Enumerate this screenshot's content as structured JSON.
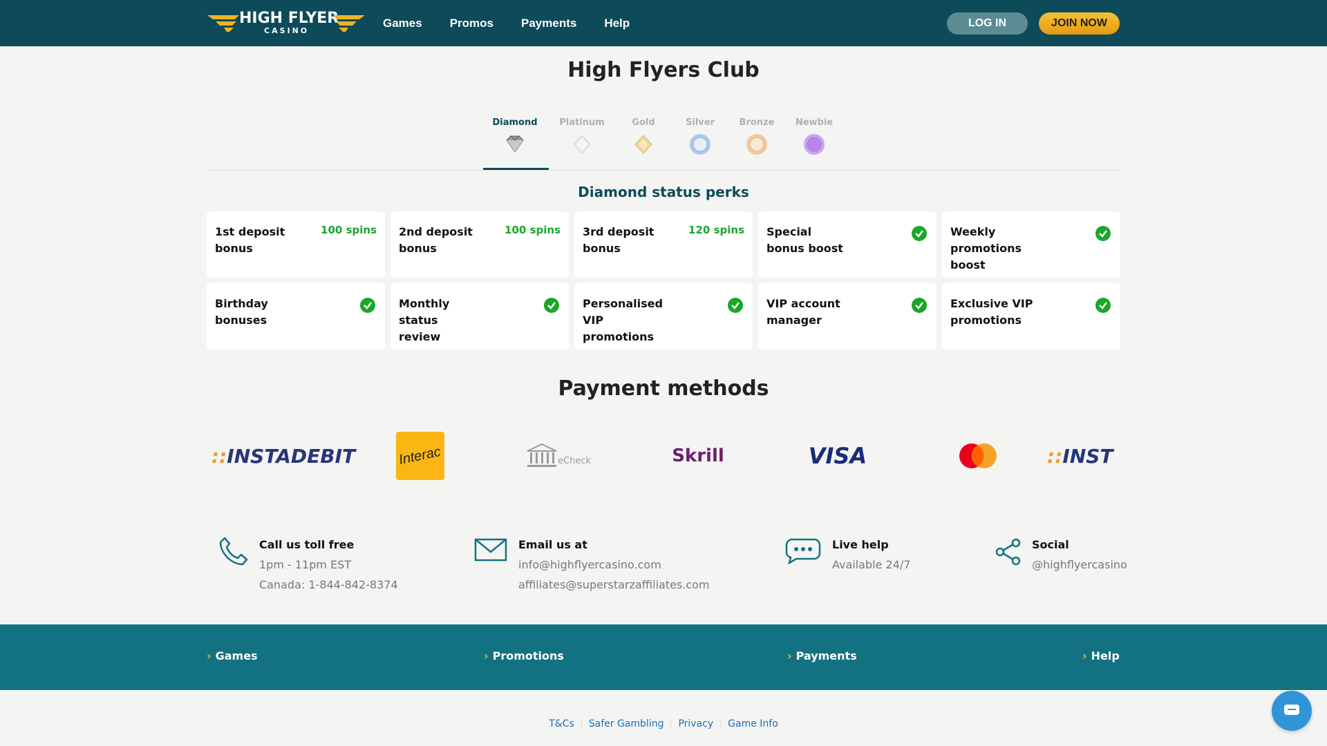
{
  "header": {
    "logo_text": "HIGH FLYER",
    "logo_sub": "CASINO",
    "nav": [
      "Games",
      "Promos",
      "Payments",
      "Help"
    ],
    "login_label": "LOG IN",
    "join_label": "JOIN NOW"
  },
  "club": {
    "title": "High Flyers Club",
    "tiers": [
      {
        "label": "Diamond",
        "active": true
      },
      {
        "label": "Platinum",
        "active": false
      },
      {
        "label": "Gold",
        "active": false
      },
      {
        "label": "Silver",
        "active": false
      },
      {
        "label": "Bronze",
        "active": false
      },
      {
        "label": "Newbie",
        "active": false
      }
    ],
    "perks_title": "Diamond status perks",
    "perks": [
      {
        "label_lines": [
          "1st deposit",
          "bonus"
        ],
        "value": "100 spins"
      },
      {
        "label_lines": [
          "2nd deposit",
          "bonus"
        ],
        "value": "100 spins"
      },
      {
        "label_lines": [
          "3rd deposit",
          "bonus"
        ],
        "value": "120 spins"
      },
      {
        "label_lines": [
          "Special",
          "bonus boost"
        ],
        "check": true
      },
      {
        "label_lines": [
          "Weekly",
          "promotions",
          "boost"
        ],
        "check": true
      },
      {
        "label_lines": [
          "Birthday",
          "bonuses"
        ],
        "check": true
      },
      {
        "label_lines": [
          "Monthly",
          "status",
          "review"
        ],
        "check": true
      },
      {
        "label_lines": [
          "Personalised",
          "VIP",
          "promotions"
        ],
        "check": true
      },
      {
        "label_lines": [
          "VIP account",
          "manager"
        ],
        "check": true
      },
      {
        "label_lines": [
          "Exclusive VIP",
          "promotions"
        ],
        "check": true
      }
    ]
  },
  "payments": {
    "title": "Payment methods",
    "methods": [
      "INSTADEBIT",
      "Interac",
      "eCheck",
      "Skrill",
      "VISA",
      "Mastercard",
      "INST"
    ]
  },
  "contacts": [
    {
      "icon": "phone-icon",
      "title": "Call us toll free",
      "lines": [
        "1pm - 11pm EST",
        "Canada: 1-844-842-8374"
      ]
    },
    {
      "icon": "envelope-icon",
      "title": "Email us at",
      "lines": [
        "info@highflyercasino.com",
        "affiliates@superstarzaffiliates.com"
      ]
    },
    {
      "icon": "chat-bubble-icon",
      "title": "Live help",
      "lines": [
        "Available 24/7"
      ]
    },
    {
      "icon": "share-icon",
      "title": "Social",
      "lines": [
        "@highflyercasino"
      ]
    }
  ],
  "footer": {
    "links": [
      "Games",
      "Promotions",
      "Payments",
      "Help"
    ],
    "legal": [
      "T&Cs",
      "Safer Gambling",
      "Privacy",
      "Game Info"
    ]
  },
  "colors": {
    "header_bg": "#0d4a5a",
    "footer_bg": "#137282",
    "accent_gold": "#f2b31f",
    "check_green": "#1aa62b"
  }
}
